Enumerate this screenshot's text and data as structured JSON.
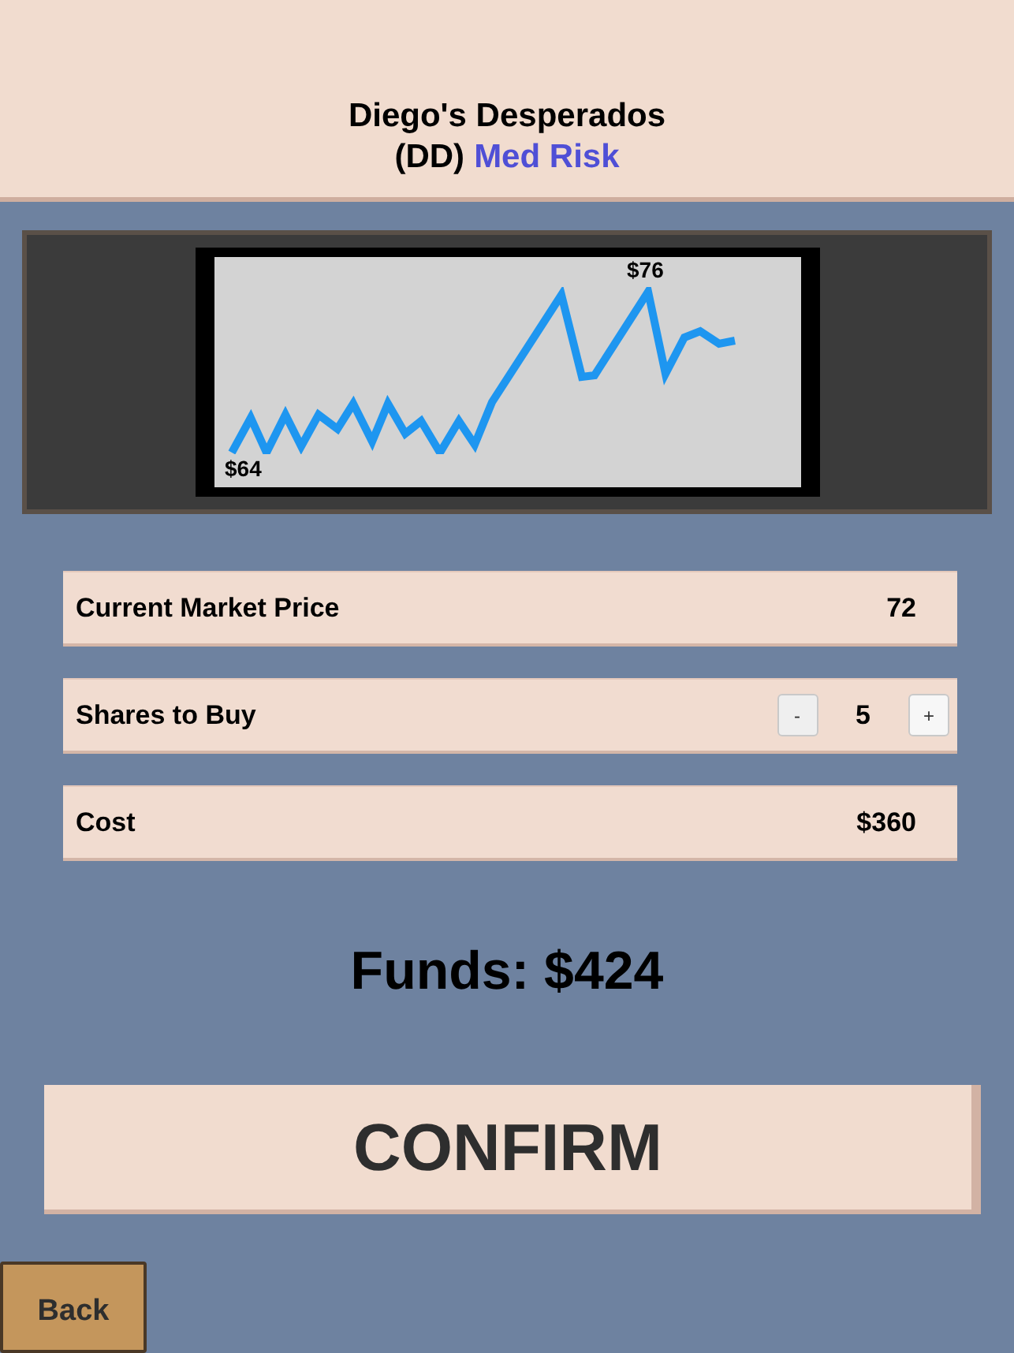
{
  "header": {
    "title": "Diego's Desperados",
    "ticker": "(DD)",
    "risk": "Med Risk"
  },
  "chart": {
    "low_label": "$64",
    "high_label": "$76"
  },
  "rows": [
    {
      "kind": "value",
      "label": "Current Market Price",
      "value": "72"
    },
    {
      "kind": "stepper",
      "label": "Shares to Buy",
      "decrement": "-",
      "value": "5",
      "increment": "+"
    },
    {
      "kind": "value",
      "label": "Cost",
      "value": "$360"
    }
  ],
  "funds": "Funds: $424",
  "confirm": "CONFIRM",
  "back": "Back"
}
